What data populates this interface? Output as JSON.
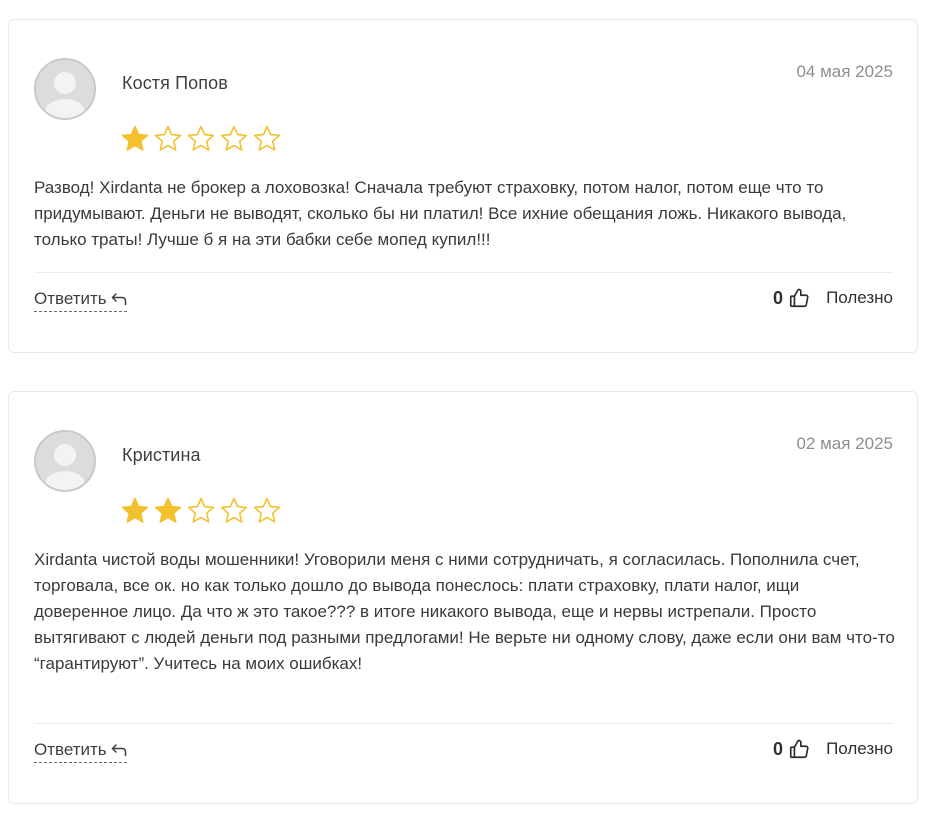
{
  "reviews": [
    {
      "author": "Костя Попов",
      "date": "04 мая 2025",
      "rating": 1,
      "max_rating": 5,
      "text": "Развод! Xirdanta не брокер а лоховозка! Сначала требуют страховку, потом налог, потом еще что то придумывают. Деньги не выводят, сколько бы ни платил! Все ихние обещания ложь. Никакого вывода, только траты! Лучше б я на эти бабки себе мопед купил!!!",
      "reply_label": "Ответить",
      "likes": "0",
      "helpful_label": "Полезно"
    },
    {
      "author": "Кристина",
      "date": "02 мая 2025",
      "rating": 2,
      "max_rating": 5,
      "text": "Xirdanta чистой воды мошенники! Уговорили меня с ними сотрудничать, я согласилась. Пополнила счет, торговала, все ок. но как только дошло до вывода понеслось: плати страховку, плати налог, ищи доверенное лицо. Да что ж это такое??? в итоге никакого вывода, еще и нервы истрепали. Просто вытягивают с людей деньги под разными предлогами! Не верьте ни одному слову, даже если они вам что-то “гарантируют”. Учитесь на моих ошибках!",
      "reply_label": "Ответить",
      "likes": "0",
      "helpful_label": "Полезно"
    }
  ],
  "icons": {
    "avatar": "user-avatar-placeholder",
    "star": "star-icon",
    "reply": "reply-arrow-icon",
    "like": "thumbs-up-icon"
  },
  "colors": {
    "star_filled": "#F2C12E",
    "star_empty_outline": "#F2C12E",
    "card_border": "#E9E9E9",
    "date_text": "#8E8E8E",
    "body_text": "#3A3A3A"
  }
}
